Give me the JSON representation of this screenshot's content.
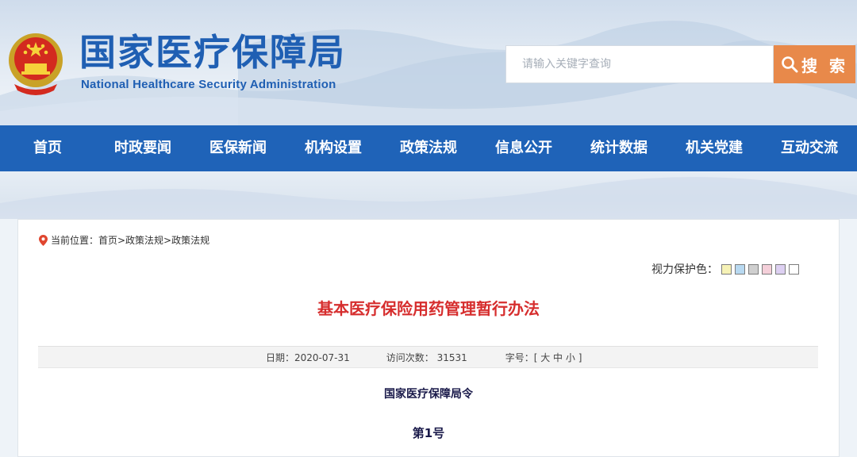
{
  "header": {
    "title_cn": "国家医疗保障局",
    "title_en": "National Healthcare Security Administration",
    "emblem_icon": "national-emblem-icon",
    "search": {
      "placeholder": "请输入关键字查询",
      "button_label": "搜 索",
      "icon": "search-icon"
    }
  },
  "nav": {
    "items": [
      {
        "label": "首页"
      },
      {
        "label": "时政要闻"
      },
      {
        "label": "医保新闻"
      },
      {
        "label": "机构设置"
      },
      {
        "label": "政策法规"
      },
      {
        "label": "信息公开"
      },
      {
        "label": "统计数据"
      },
      {
        "label": "机关党建"
      },
      {
        "label": "互动交流"
      }
    ]
  },
  "breadcrumb": {
    "icon": "location-pin-icon",
    "text": "当前位置：首页>政策法规>政策法规"
  },
  "eyecare": {
    "label": "视力保护色：",
    "swatches": [
      "#f6f2b6",
      "#b8d9f1",
      "#cfcfcf",
      "#f4cfd9",
      "#ddd0f2",
      "#ffffff"
    ]
  },
  "article": {
    "title": "基本医疗保险用药管理暂行办法",
    "date": "日期：2020-07-31",
    "visits": "访问次数： 31531",
    "font_size": "字号：[ 大 中 小 ]",
    "issuer": "国家医疗保障局令",
    "number": "第1号"
  },
  "colors": {
    "nav_bg": "#1f63b8",
    "title_blue": "#1f5fb3",
    "search_btn": "#e8894a",
    "article_title": "#d62d2d"
  }
}
